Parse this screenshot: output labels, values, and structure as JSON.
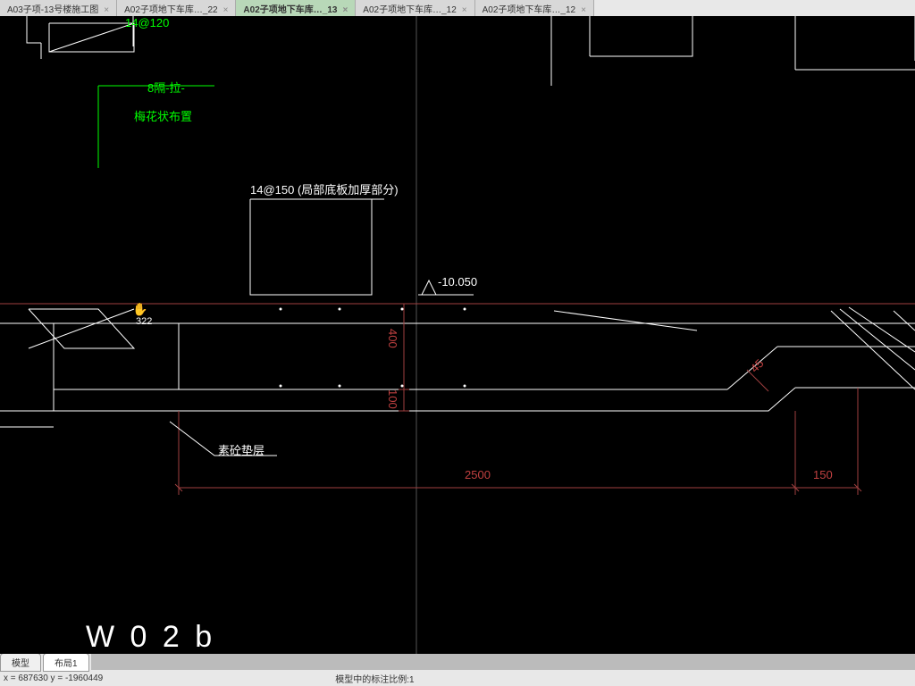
{
  "tabs": [
    {
      "label": "A03子项-13号楼施工图"
    },
    {
      "label": "A02子项地下车库…_22"
    },
    {
      "label": "A02子项地下车库…_13"
    },
    {
      "label": "A02子项地下车库…_12"
    },
    {
      "label": "A02子项地下车库…_12"
    }
  ],
  "active_tab_index": 2,
  "bottom_tabs": {
    "model": "模型",
    "layout1": "布局1"
  },
  "status": {
    "coords": "x = 687630  y = -1960449",
    "scale_label": "模型中的标注比例:1"
  },
  "annot": {
    "green_top": "14@120",
    "green_label1": "8隔-拉-",
    "green_label2": "梅花状布置",
    "rebar_label": "14@150 (局部底板加厚部分)",
    "elev": "-10.050",
    "dim_400": "400",
    "dim_100": "100",
    "dim_2500": "2500",
    "dim_150": "150",
    "concrete_layer": "素砼垫层",
    "mark_322": "322",
    "mark_45": "45",
    "big_label": "W 0 2 b"
  },
  "colors": {
    "green": "#00ff00",
    "white": "#ffffff",
    "red_dim": "#c04040",
    "gray": "#555555"
  }
}
